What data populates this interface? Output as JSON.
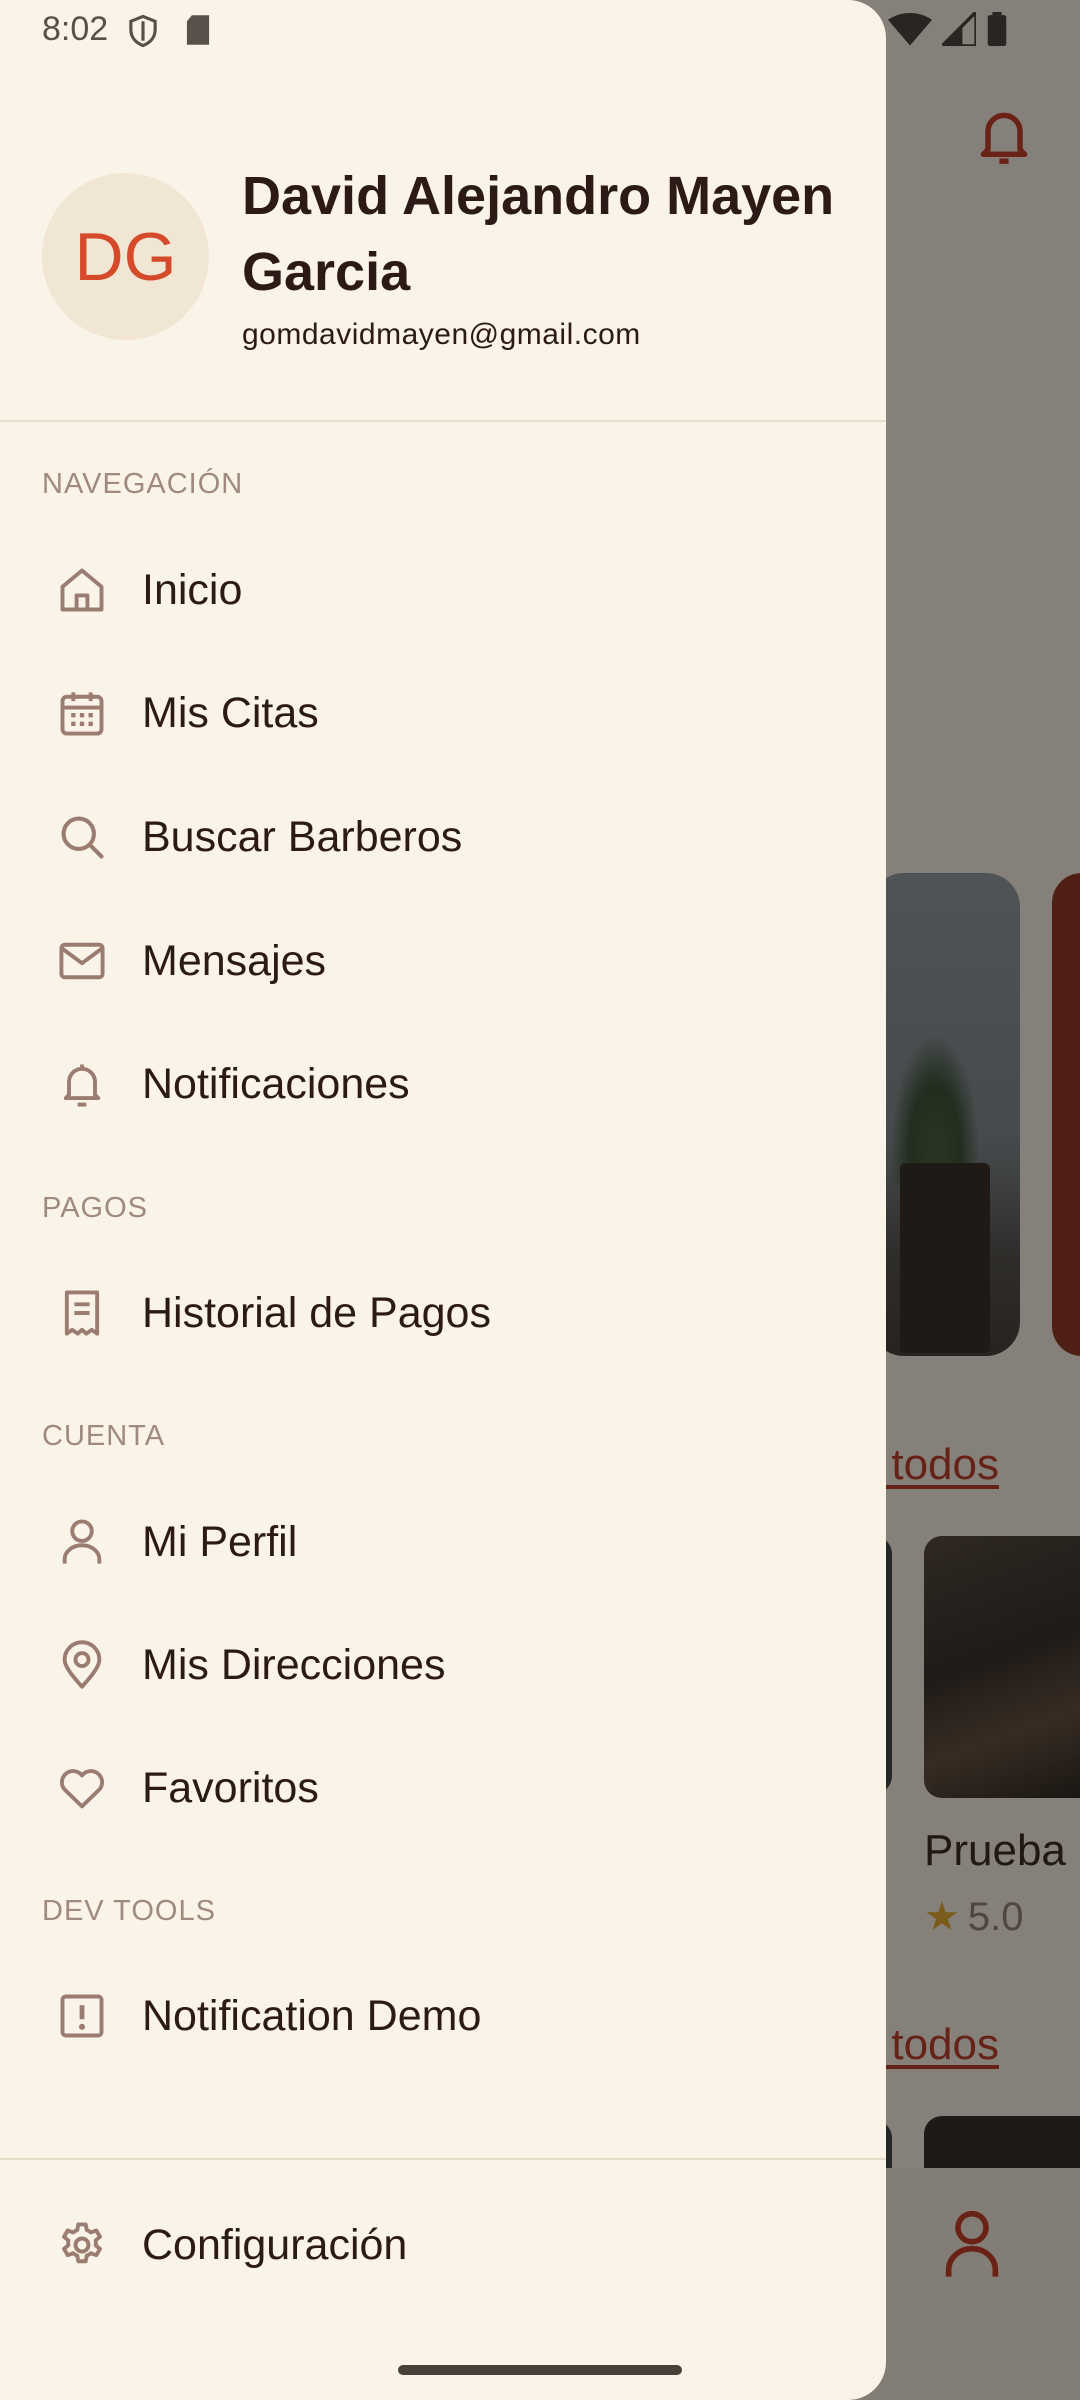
{
  "status_bar": {
    "time": "8:02"
  },
  "profile": {
    "initials": "DG",
    "name": "David Alejandro Mayen Garcia",
    "email": "gomdavidmayen@gmail.com"
  },
  "sections": {
    "navegacion": "NAVEGACIÓN",
    "pagos": "PAGOS",
    "cuenta": "CUENTA",
    "dev_tools": "DEV TOOLS"
  },
  "menu": {
    "inicio": {
      "label": "Inicio",
      "icon": "home-icon"
    },
    "mis_citas": {
      "label": "Mis Citas",
      "icon": "calendar-icon"
    },
    "buscar_barberos": {
      "label": "Buscar Barberos",
      "icon": "search-icon"
    },
    "mensajes": {
      "label": "Mensajes",
      "icon": "mail-icon"
    },
    "notificaciones": {
      "label": "Notificaciones",
      "icon": "bell-icon"
    },
    "historial_pagos": {
      "label": "Historial de Pagos",
      "icon": "receipt-icon"
    },
    "mi_perfil": {
      "label": "Mi Perfil",
      "icon": "person-icon"
    },
    "mis_direcciones": {
      "label": "Mis Direcciones",
      "icon": "location-pin-icon"
    },
    "favoritos": {
      "label": "Favoritos",
      "icon": "heart-icon"
    },
    "notification_demo": {
      "label": "Notification Demo",
      "icon": "alert-square-icon"
    },
    "configuracion": {
      "label": "Configuración",
      "icon": "gear-icon"
    }
  },
  "background": {
    "link_ver_todos_1": "er todos",
    "link_ver_todos_2": "er todos",
    "card_title": "Prueba",
    "card_rating": "5.0"
  },
  "colors": {
    "drawer_bg": "#faf3e7",
    "text_primary": "#2b1a15",
    "accent": "#d64a2c",
    "icon_color": "#9b7c70",
    "section_label": "#a08a7e"
  }
}
